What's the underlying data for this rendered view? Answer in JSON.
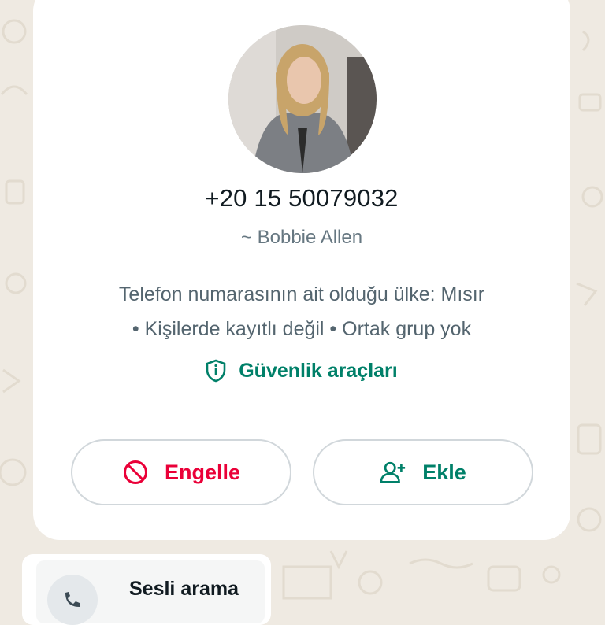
{
  "contact": {
    "phone": "+20 15 50079032",
    "pushname": "~ Bobbie Allen",
    "info_line1": "Telefon numarasının ait olduğu ülke: Mısır",
    "info_line2": "• Kişilerde kayıtlı değil • Ortak grup yok"
  },
  "safety_tools": {
    "label": "Güvenlik araçları",
    "icon": "shield-icon"
  },
  "actions": {
    "block_label": "Engelle",
    "block_icon": "block-icon",
    "add_label": "Ekle",
    "add_icon": "add-person-icon"
  },
  "call_message": {
    "label": "Sesli arama",
    "icon": "missed-call-icon"
  },
  "colors": {
    "accent_green": "#008069",
    "danger_red": "#ea0038",
    "chat_background": "#efeae2"
  }
}
